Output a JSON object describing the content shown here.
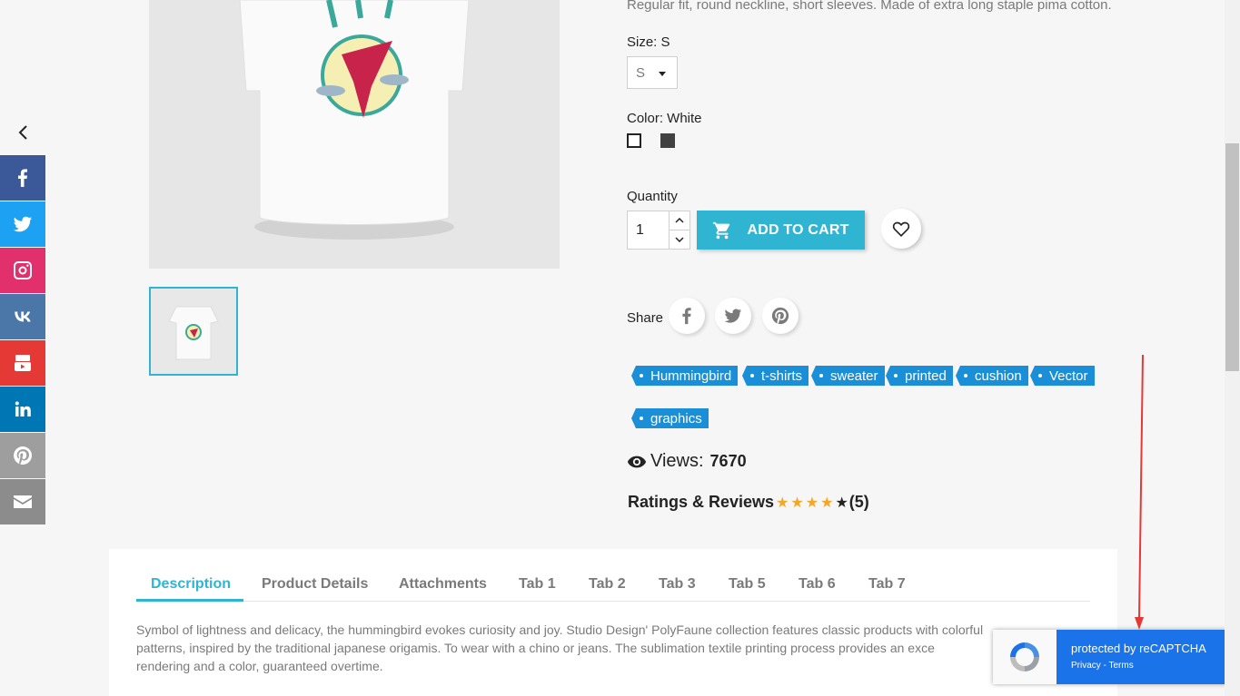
{
  "product": {
    "short_description": "Regular fit, round neckline, short sleeves. Made of extra long staple pima cotton.",
    "size_label": "Size: S",
    "size_value": "S",
    "color_label": "Color: White",
    "colors": [
      "#ffffff",
      "#414141"
    ],
    "quantity_label": "Quantity",
    "quantity_value": "1",
    "add_to_cart_label": "ADD TO CART",
    "share_label": "Share"
  },
  "tags": [
    "Hummingbird",
    "t-shirts",
    "sweater",
    "printed",
    "cushion",
    "Vector",
    "graphics"
  ],
  "stats": {
    "views_label": "Views:",
    "views_value": "7670",
    "ratings_label": "Ratings & Reviews",
    "rating_stars": 4,
    "rating_max": 5,
    "rating_count": "(5)"
  },
  "tabs": [
    "Description",
    "Product Details",
    "Attachments",
    "Tab 1",
    "Tab 2",
    "Tab 3",
    "Tab 5",
    "Tab 6",
    "Tab 7"
  ],
  "active_tab": "Description",
  "description_lines": [
    "Symbol of lightness and delicacy, the hummingbird evokes curiosity and joy. Studio Design' PolyFaune collection features classic products with colorful",
    "patterns, inspired by the traditional japanese origamis. To wear with a chino or jeans. The sublimation textile printing process provides an exce",
    "rendering and a color, guaranteed overtime."
  ],
  "social": [
    {
      "name": "facebook-icon",
      "color": "#3b5998"
    },
    {
      "name": "twitter-icon",
      "color": "#1da1f2"
    },
    {
      "name": "instagram-icon",
      "color": "#e1306c"
    },
    {
      "name": "vk-icon",
      "color": "#4a76a8"
    },
    {
      "name": "youtube-icon",
      "color": "#e53935"
    },
    {
      "name": "linkedin-icon",
      "color": "#0077b5"
    },
    {
      "name": "pinterest-icon",
      "color": "#9e9e9e"
    },
    {
      "name": "email-icon",
      "color": "#8c8c8c"
    }
  ],
  "recaptcha": {
    "title": "protected by reCAPTCHA",
    "links": "Privacy - Terms"
  },
  "colors": {
    "accent": "#2fb5d2",
    "tag": "#1a8fd8",
    "star_filled": "#f5a623",
    "annotation_arrow": "#e53935"
  }
}
